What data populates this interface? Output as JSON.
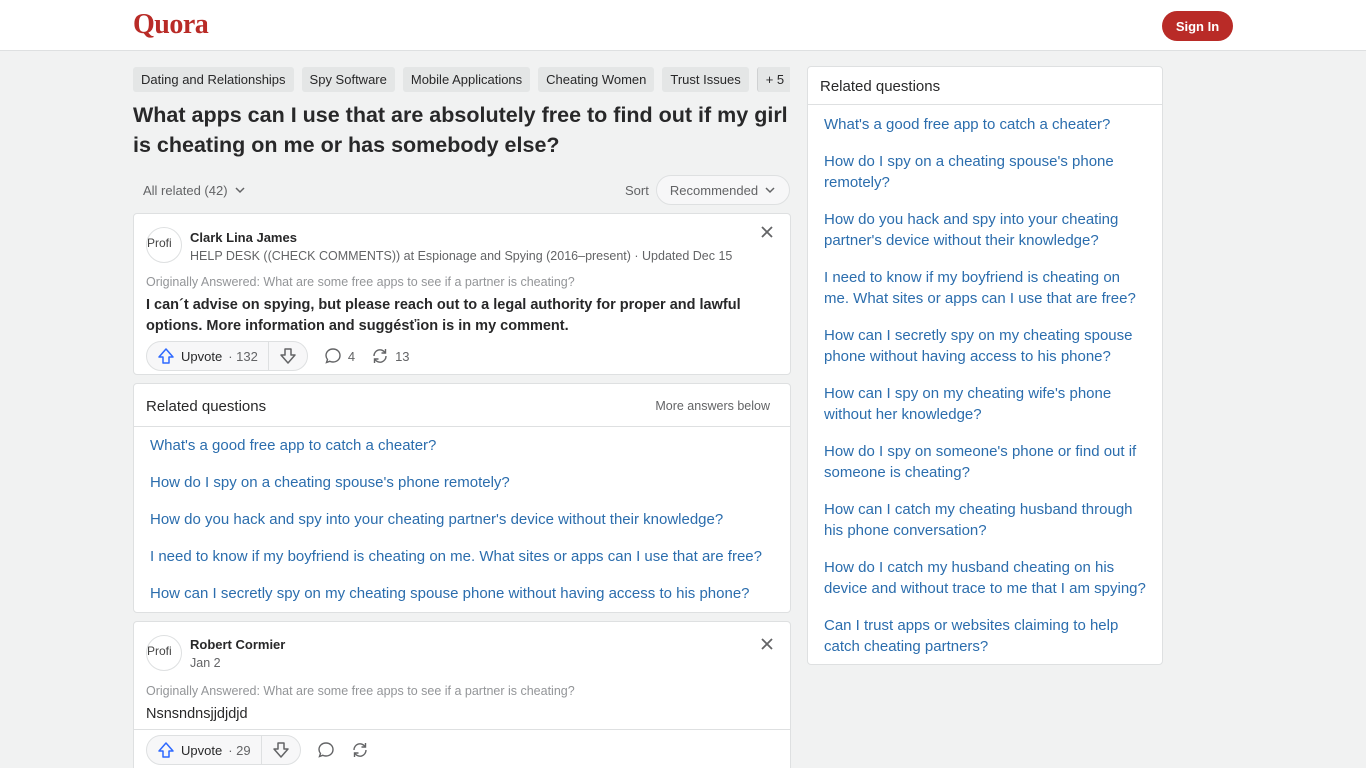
{
  "header": {
    "logo": "Quora",
    "signin_label": "Sign In",
    "brand_color": "#b92b27"
  },
  "tags": [
    "Dating and Relationships",
    "Spy Software",
    "Mobile Applications",
    "Cheating Women",
    "Trust Issues"
  ],
  "tags_more": "+ 5",
  "question": {
    "title": "What apps can I use that are absolutely free to find out if my girl is cheating on me or has somebody else?"
  },
  "filter": {
    "all_related": "All related (42)",
    "sort_label": "Sort",
    "sort_value": "Recommended"
  },
  "answers": [
    {
      "avatar_alt": "Profi",
      "author": "Clark Lina James",
      "credential": "HELP DESK ((CHECK COMMENTS)) at Espionage and Spying (2016–present) · Updated Dec 15",
      "originally_answered": "Originally Answered: What are some free apps to see if a partner is cheating?",
      "text": "I can´t advise on spying, but please reach out to a legal authority for proper and lawful options. More information and suggésťion is in my comment.",
      "upvote_label": "Upvote",
      "upvotes": "· 132",
      "comments": "4",
      "shares": "13"
    },
    {
      "avatar_alt": "Profi",
      "author": "Robert Cormier",
      "credential": "Jan 2",
      "originally_answered": "Originally Answered: What are some free apps to see if a partner is cheating?",
      "text": "Nsnsndnsjjdjdjd",
      "upvote_label": "Upvote",
      "upvotes": "· 29"
    }
  ],
  "related_inline": {
    "title": "Related questions",
    "more": "More answers below",
    "items": [
      "What's a good free app to catch a cheater?",
      "How do I spy on a cheating spouse's phone remotely?",
      "How do you hack and spy into your cheating partner's device without their knowledge?",
      "I need to know if my boyfriend is cheating on me. What sites or apps can I use that are free?",
      "How can I secretly spy on my cheating spouse phone without having access to his phone?"
    ]
  },
  "related_sidebar": {
    "title": "Related questions",
    "items": [
      "What's a good free app to catch a cheater?",
      "How do I spy on a cheating spouse's phone remotely?",
      "How do you hack and spy into your cheating partner's device without their knowledge?",
      "I need to know if my boyfriend is cheating on me. What sites or apps can I use that are free?",
      "How can I secretly spy on my cheating spouse phone without having access to his phone?",
      "How can I spy on my cheating wife's phone without her knowledge?",
      "How do I spy on someone's phone or find out if someone is cheating?",
      "How can I catch my cheating husband through his phone conversation?",
      "How do I catch my husband cheating on his device and without trace to me that I am spying?",
      "Can I trust apps or websites claiming to help catch cheating partners?"
    ]
  }
}
